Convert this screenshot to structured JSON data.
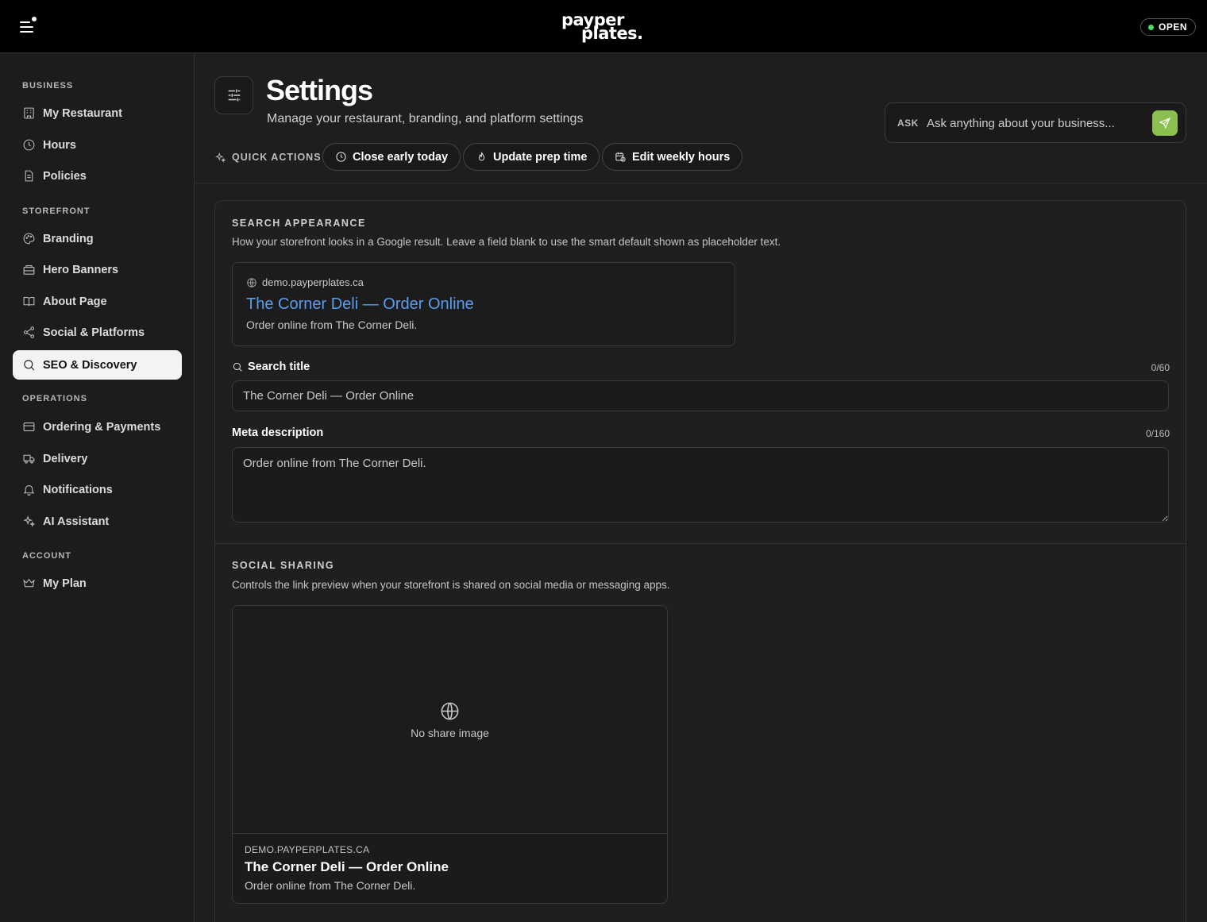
{
  "topbar": {
    "logo_line1": "payper",
    "logo_line2": "plates.",
    "status": "OPEN"
  },
  "sidebar": {
    "sections": [
      {
        "title": "BUSINESS",
        "items": [
          "My Restaurant",
          "Hours",
          "Policies"
        ]
      },
      {
        "title": "STOREFRONT",
        "items": [
          "Branding",
          "Hero Banners",
          "About Page",
          "Social & Platforms",
          "SEO & Discovery"
        ]
      },
      {
        "title": "OPERATIONS",
        "items": [
          "Ordering & Payments",
          "Delivery",
          "Notifications",
          "AI Assistant"
        ]
      },
      {
        "title": "ACCOUNT",
        "items": [
          "My Plan"
        ]
      }
    ],
    "active_item": "SEO & Discovery"
  },
  "header": {
    "title": "Settings",
    "subtitle": "Manage your restaurant, branding, and platform settings",
    "ask_label": "ASK",
    "ask_placeholder": "Ask anything about your business...",
    "quick_actions_label": "QUICK ACTIONS",
    "quick_actions": [
      "Close early today",
      "Update prep time",
      "Edit weekly hours"
    ]
  },
  "search_appearance": {
    "title": "SEARCH APPEARANCE",
    "description": "How your storefront looks in a Google result. Leave a field blank to use the smart default shown as placeholder text.",
    "preview": {
      "url": "demo.payperplates.ca",
      "title": "The Corner Deli — Order Online",
      "description": "Order online from The Corner Deli."
    },
    "search_title": {
      "label": "Search title",
      "counter": "0/60",
      "value": "",
      "placeholder": "The Corner Deli — Order Online"
    },
    "meta_description": {
      "label": "Meta description",
      "counter": "0/160",
      "value": "",
      "placeholder": "Order online from The Corner Deli."
    }
  },
  "social_sharing": {
    "title": "SOCIAL SHARING",
    "description": "Controls the link preview when your storefront is shared on social media or messaging apps.",
    "preview": {
      "image_placeholder": "No share image",
      "domain": "DEMO.PAYPERPLATES.CA",
      "title": "The Corner Deli — Order Online",
      "description": "Order online from The Corner Deli."
    }
  },
  "colors": {
    "accent_green": "#8bbf4f",
    "link_blue": "#5a9cf0",
    "status_green": "#4cd964"
  }
}
